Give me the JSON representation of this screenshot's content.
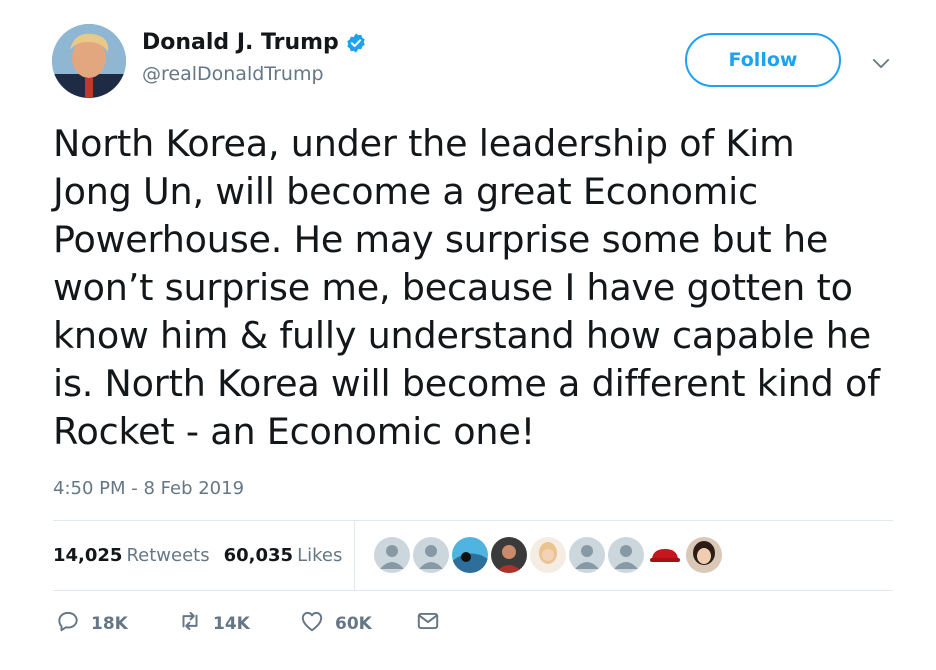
{
  "author": {
    "display_name": "Donald J. Trump",
    "handle": "@realDonaldTrump",
    "verified": true
  },
  "follow_button": {
    "label": "Follow"
  },
  "tweet": {
    "lines": [
      "North Korea, under the leadership of Kim",
      "Jong Un, will become a great Economic",
      "Powerhouse. He may surprise some but he",
      "won’t surprise me, because I have gotten to",
      "know him & fully understand how capable he",
      "is. North Korea will become a different kind of",
      "Rocket - an Economic one!"
    ],
    "timestamp": "4:50 PM - 8 Feb 2019"
  },
  "stats": {
    "retweets_count": "14,025",
    "retweets_label": "Retweets",
    "likes_count": "60,035",
    "likes_label": "Likes"
  },
  "actions": {
    "reply_count": "18K",
    "retweet_count": "14K",
    "like_count": "60K"
  },
  "colors": {
    "accent": "#1da1f2",
    "muted": "#657786",
    "text": "#14171a",
    "divider": "#e1e8ed"
  },
  "icons": [
    "verified-badge-icon",
    "chevron-down-icon",
    "reply-icon",
    "retweet-icon",
    "heart-icon",
    "message-icon"
  ]
}
